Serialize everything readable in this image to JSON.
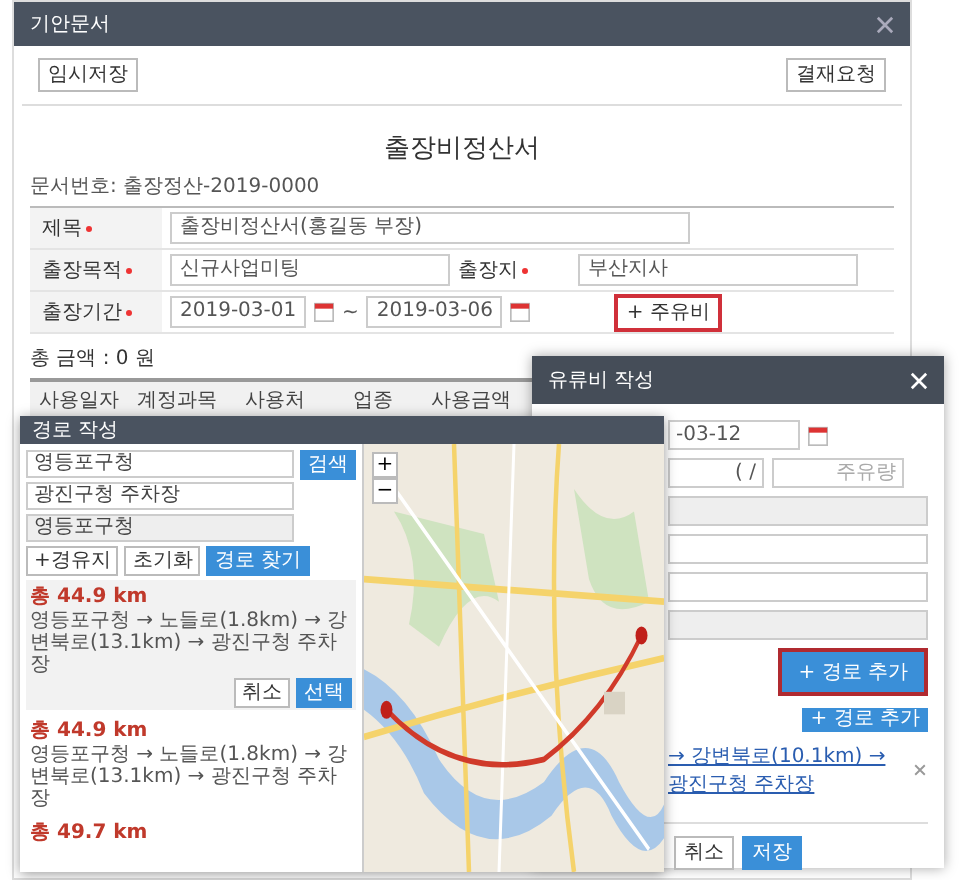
{
  "main_window": {
    "title": "기안문서"
  },
  "toolbar": {
    "save_draft": "임시저장",
    "request_approval": "결재요청"
  },
  "document": {
    "title": "출장비정산서",
    "number": "문서번호: 출장정산-2019-0000"
  },
  "form": {
    "subject": {
      "label": "제목",
      "required": true,
      "value": "출장비정산서(홍길동 부장)"
    },
    "purpose": {
      "label": "출장목적",
      "required": true,
      "value": "신규사업미팅"
    },
    "destination": {
      "label": "출장지",
      "required": true,
      "value": "부산지사"
    },
    "period": {
      "label": "출장기간",
      "required": true,
      "start": "2019-03-01",
      "separator": "~",
      "end": "2019-03-06"
    }
  },
  "fuel_button": {
    "label": "+ 주유비",
    "highlighted": true
  },
  "total": "총 금액 : 0 원",
  "table": {
    "columns": [
      "사용일자",
      "계정과목",
      "사용처",
      "업종",
      "사용금액"
    ]
  },
  "route_window": {
    "title": "경로 작성",
    "inputs": [
      {
        "value": "영등포구청",
        "kind": "select"
      },
      {
        "value": "광진구청 주차장",
        "kind": "select"
      },
      {
        "value": "영등포구청",
        "kind": "text"
      }
    ],
    "search_button": "검색",
    "waypoint_button": "+경유지",
    "reset_button": "초기화",
    "find_button": "경로 찾기",
    "routes": [
      {
        "distance": "총 44.9 km",
        "path": "영등포구청 → 노들로(1.8km) → 강변북로(13.1km) → 광진구청 주차장",
        "selected": true
      },
      {
        "distance": "총 44.9 km",
        "path": "영등포구청 → 노들로(1.8km) → 강변북로(13.1km) → 광진구청 주차장",
        "selected": false
      },
      {
        "distance": "총 49.7 km",
        "selected": false
      }
    ],
    "cancel_button": "취소",
    "select_button": "선택",
    "map_controls": [
      "+",
      "−"
    ]
  },
  "fuel_dialog": {
    "title": "유류비 작성",
    "date": "-03-12",
    "separator": "( /",
    "amount_placeholder": "주유량",
    "add_route_button": {
      "label": "+ 경로 추가",
      "highlighted": true
    },
    "add_route_small": "+ 경로 추가",
    "route_link": "→ 강변북로(10.1km) → 광진구청 주차장",
    "cancel_button": "취소",
    "save_button": "저장"
  }
}
